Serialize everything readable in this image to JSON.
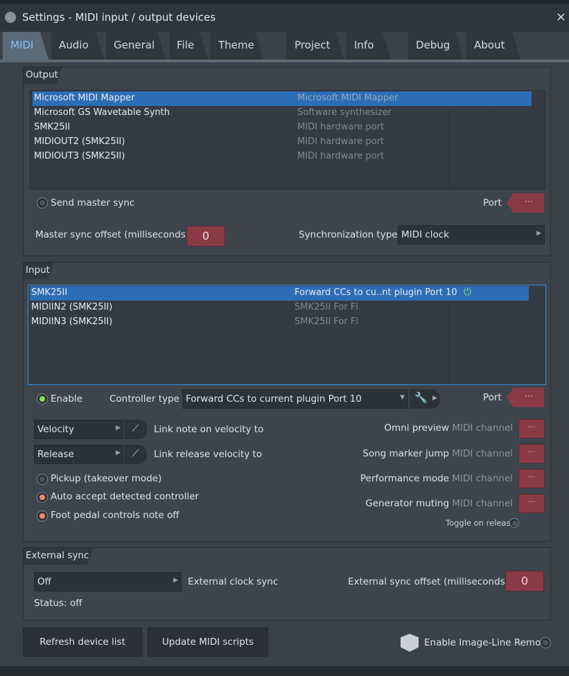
{
  "window": {
    "title": "Settings - MIDI input / output devices",
    "close": "×"
  },
  "tabs": [
    "MIDI",
    "Audio",
    "General",
    "File",
    "Theme",
    "Project",
    "Info",
    "Debug",
    "About"
  ],
  "output": {
    "label": "Output",
    "devices": [
      {
        "name": "Microsoft MIDI Mapper",
        "type": "Microsoft MIDI Mapper"
      },
      {
        "name": "Microsoft GS Wavetable Synth",
        "type": "Software synthesizer"
      },
      {
        "name": "SMK25II",
        "type": "MIDI hardware port"
      },
      {
        "name": "MIDIOUT2 (SMK25II)",
        "type": "MIDI hardware port"
      },
      {
        "name": "MIDIOUT3 (SMK25II)",
        "type": "MIDI hardware port"
      }
    ],
    "send_master_sync": "Send master sync",
    "port_label": "Port",
    "port_value": "···",
    "master_sync_offset_label": "Master sync offset (milliseconds)",
    "master_sync_offset_value": "0",
    "sync_type_label": "Synchronization type",
    "sync_type_value": "MIDI clock"
  },
  "input": {
    "label": "Input",
    "devices": [
      {
        "name": "SMK25II",
        "type": "Forward CCs to cu..nt plugin Port 10"
      },
      {
        "name": "MIDIIN2 (SMK25II)",
        "type": "SMK25II For Fl"
      },
      {
        "name": "MIDIIN3 (SMK25II)",
        "type": "SMK25II For Fl"
      }
    ],
    "enable": "Enable",
    "controller_type_label": "Controller type",
    "controller_type_value": "Forward CCs to current plugin Port 10",
    "port_label": "Port",
    "port_value": "···",
    "velocity_select": "Velocity",
    "link_note_velocity": "Link note on velocity to",
    "release_select": "Release",
    "link_release_velocity": "Link release velocity to",
    "pickup": "Pickup (takeover mode)",
    "auto_accept": "Auto accept detected controller",
    "foot_pedal": "Foot pedal controls note off",
    "midi_channel": "MIDI channel",
    "omni_preview": "Omni preview",
    "song_marker_jump": "Song marker jump",
    "performance_mode": "Performance mode",
    "generator_muting": "Generator muting",
    "channel_value": "···",
    "toggle_on_release": "Toggle on release"
  },
  "external_sync": {
    "label": "External sync",
    "mode_value": "Off",
    "external_clock_sync": "External clock sync",
    "offset_label": "External sync offset (milliseconds)",
    "offset_value": "0",
    "status": "Status: off"
  },
  "buttons": {
    "refresh": "Refresh device list",
    "update_scripts": "Update MIDI scripts",
    "image_line_remote": "Enable Image-Line Remote"
  },
  "colors": {
    "accent": "#7fc4ff",
    "selection": "#2d6db5",
    "counter": "#8a3a45",
    "enabled": "#8be05a"
  }
}
